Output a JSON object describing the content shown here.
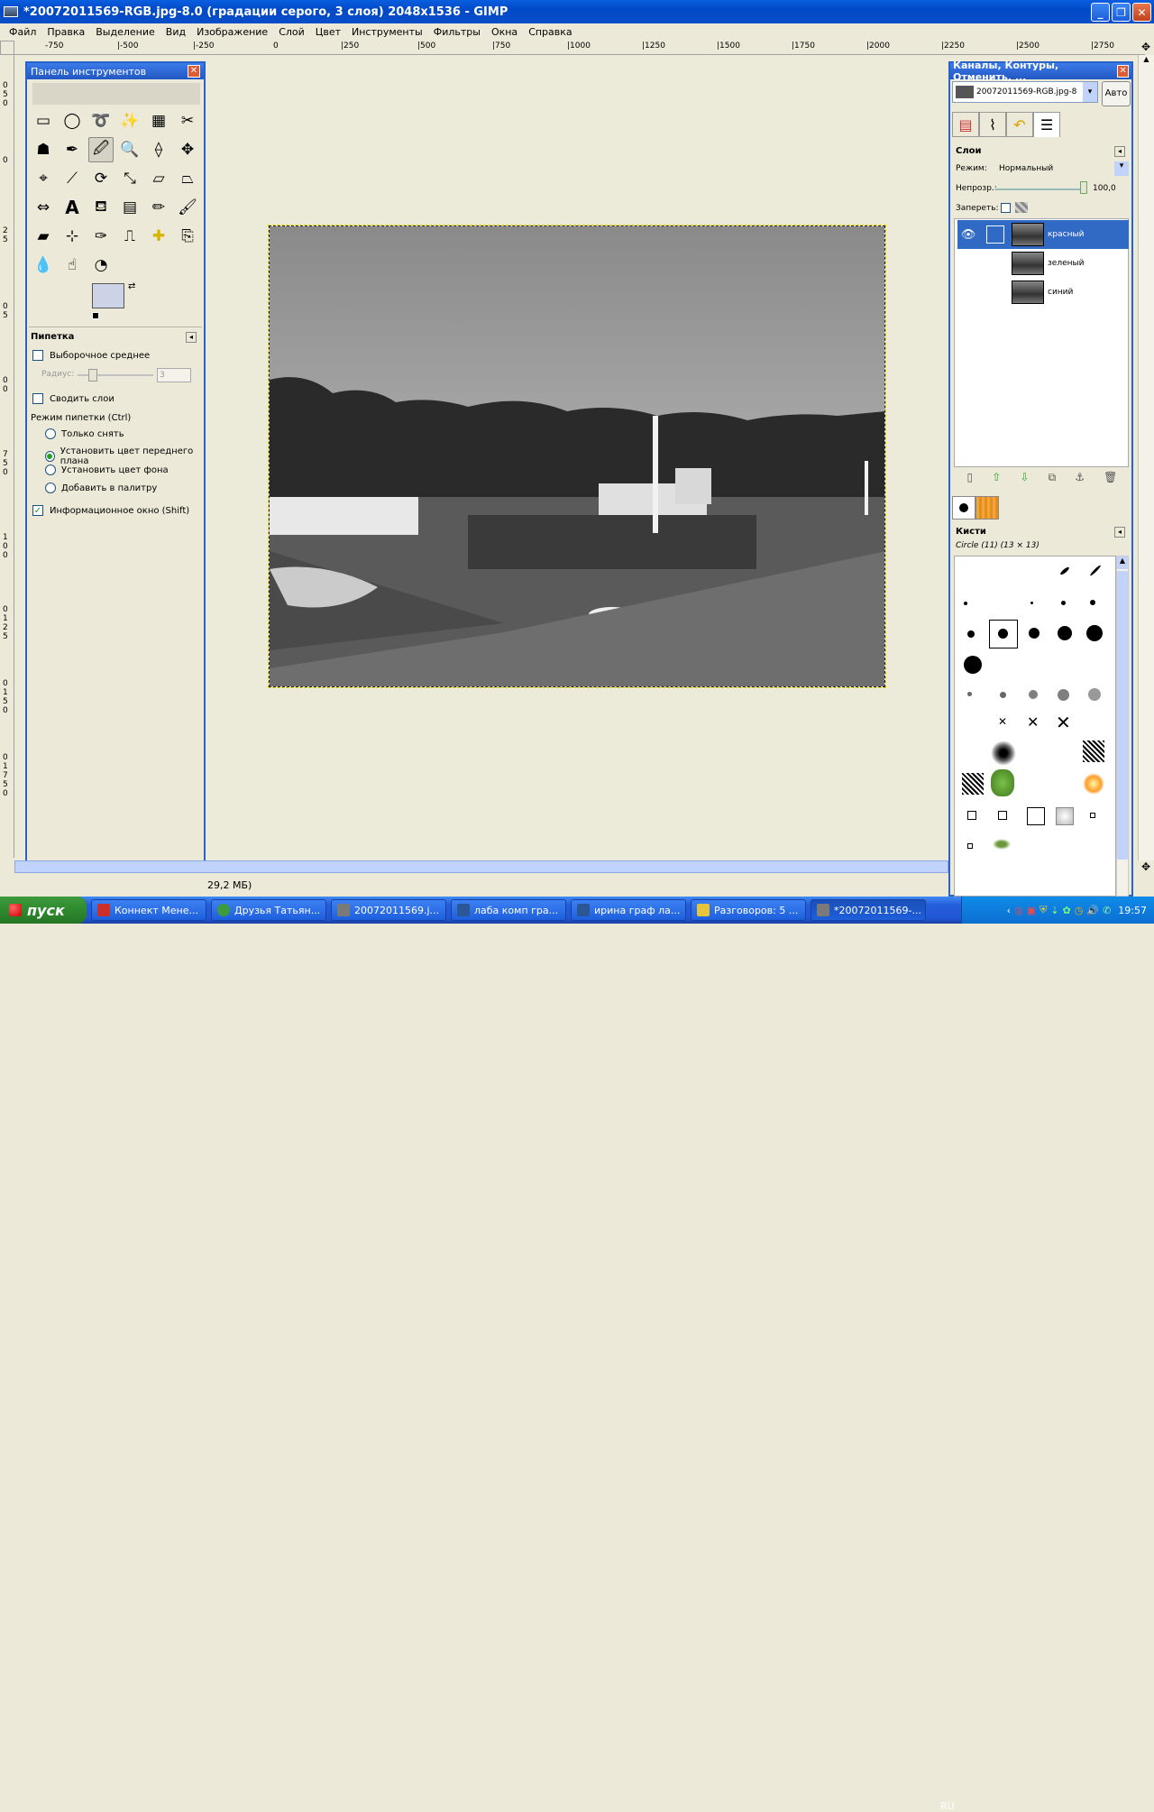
{
  "window": {
    "title": "*20072011569-RGB.jpg-8.0 (градации серого, 3 слоя) 2048x1536 - GIMP",
    "controls": [
      "_",
      "❐",
      "✕"
    ]
  },
  "menu": [
    "Файл",
    "Правка",
    "Выделение",
    "Вид",
    "Изображение",
    "Слой",
    "Цвет",
    "Инструменты",
    "Фильтры",
    "Окна",
    "Справка"
  ],
  "hruler": [
    "-750",
    "|-500",
    "|-250",
    "0",
    "|250",
    "|500",
    "|750",
    "|1000",
    "|1250",
    "|1500",
    "|1750",
    "|2000",
    "|2250",
    "|2500",
    "|2750"
  ],
  "vruler": [
    "0",
    "5",
    "0",
    "0",
    "2",
    "5",
    "0",
    "5",
    "0",
    "0",
    "7",
    "5",
    "0",
    "1",
    "0",
    "0",
    "0",
    "1",
    "2",
    "5",
    "0",
    "1",
    "5",
    "0",
    "0",
    "1",
    "7",
    "5",
    "0"
  ],
  "toolbox": {
    "title": "Панель инструментов",
    "options": {
      "tool_name": "Пипетка",
      "sample_average": "Выборочное среднее",
      "radius_label": "Радиус:",
      "radius_value": "3",
      "sample_merged": "Сводить слои",
      "mode_label": "Режим пипетки (Ctrl)",
      "modes": [
        "Только снять",
        "Установить цвет переднего плана",
        "Установить цвет фона",
        "Добавить в палитру"
      ],
      "info_window": "Информационное окно (Shift)"
    }
  },
  "dock": {
    "title": "Каналы, Контуры, Отменить, ...",
    "image_select": "20072011569-RGB.jpg-8",
    "auto_button": "Авто",
    "layers": {
      "header": "Слои",
      "mode_label": "Режим:",
      "mode_value": "Нормальный",
      "opacity_label": "Непрозр.:",
      "opacity_value": "100,0",
      "lock_label": "Запереть:",
      "items": [
        "красный",
        "зеленый",
        "синий"
      ]
    },
    "brushes": {
      "header": "Кисти",
      "current": "Circle (11) (13 × 13)"
    }
  },
  "status": {
    "text": "29,2 МБ)"
  },
  "taskbar": {
    "start": "пуск",
    "tasks": [
      {
        "label": "Коннект Мене...",
        "color": "#c9302c"
      },
      {
        "label": "Друзья Татьян...",
        "color": "#3d9b3d"
      },
      {
        "label": "20072011569.j...",
        "color": "#7a7a7a"
      },
      {
        "label": "лаба комп гра...",
        "color": "#2b5797"
      },
      {
        "label": "ирина граф ла...",
        "color": "#2b5797"
      },
      {
        "label": "Разговоров: 5 ...",
        "color": "#e8c43a"
      },
      {
        "label": "*20072011569-...",
        "color": "#7a7a7a"
      }
    ],
    "lang": "RU",
    "clock": "19:57"
  }
}
